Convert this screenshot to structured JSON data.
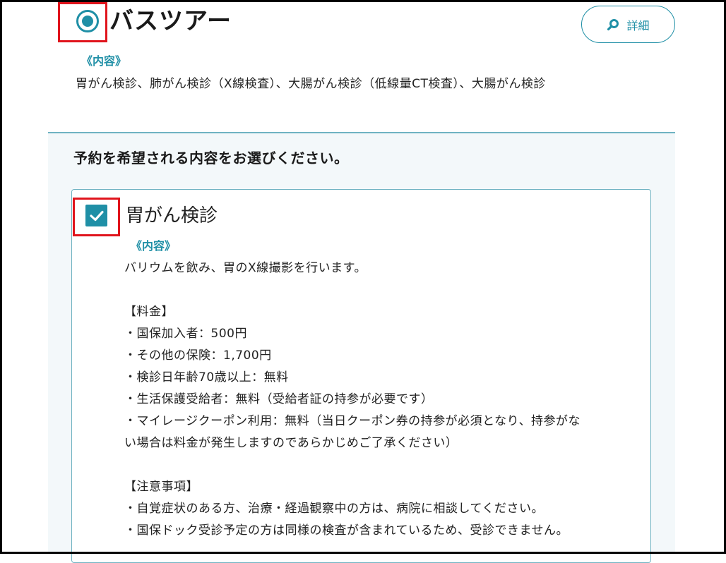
{
  "header": {
    "title": "バスツアー",
    "detail_button_label": "詳細",
    "content_label": "《内容》",
    "content_text": "胃がん検診、肺がん検診（X線検査）、大腸がん検診（低線量CT検査）、大腸がん検診"
  },
  "selection": {
    "prompt": "予約を希望される内容をお選びください。",
    "option": {
      "title": "胃がん検診",
      "checked": true,
      "content_label": "《内容》",
      "lines": [
        "バリウムを飲み、胃のX線撮影を行います。",
        "",
        "【料金】",
        "・国保加入者：500円",
        "・その他の保険：1,700円",
        "・検診日年齢70歳以上：無料",
        "・生活保護受給者：無料（受給者証の持参が必要です）",
        "・マイレージクーポン利用：無料（当日クーポン券の持参が必須となり、持参がな",
        "い場合は料金が発生しますのであらかじめご了承ください）",
        "",
        "【注意事項】",
        "・自覚症状のある方、治療・経過観察中の方は、病院に相談してください。",
        "・国保ドック受診予定の方は同様の検査が含まれているため、受診できません。"
      ]
    }
  },
  "colors": {
    "accent": "#1f8fa6",
    "highlight_border": "#e0141c",
    "panel_bg": "#f3f8fa"
  },
  "icons": {
    "detail": "search-icon",
    "radio": "radio-selected-icon",
    "checkbox": "checkmark-icon"
  }
}
